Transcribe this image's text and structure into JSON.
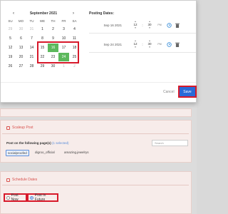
{
  "calendar": {
    "month_label": "September 2021",
    "prev_label": "‹",
    "next_label": "›",
    "weekdays": [
      "SU",
      "MO",
      "TU",
      "WE",
      "TH",
      "FR",
      "SA"
    ],
    "weeks": [
      [
        "29",
        "30",
        "31",
        "1",
        "2",
        "3",
        "4"
      ],
      [
        "5",
        "6",
        "7",
        "8",
        "9",
        "10",
        "11"
      ],
      [
        "12",
        "13",
        "14",
        "15",
        "16",
        "17",
        "18"
      ],
      [
        "19",
        "20",
        "21",
        "22",
        "23",
        "24",
        "25"
      ],
      [
        "26",
        "27",
        "28",
        "29",
        "30",
        "1",
        "2"
      ]
    ]
  },
  "posting": {
    "label": "Posting Dates:",
    "rows": [
      {
        "date": "Sep 16 2021",
        "hour": "12",
        "minute": "30",
        "meridian": "PM"
      },
      {
        "date": "Sep 24 2021",
        "hour": "12",
        "minute": "30",
        "meridian": "PM"
      }
    ],
    "time_up": "▴",
    "time_down": "▾",
    "colon": ":"
  },
  "footer": {
    "cancel_label": "Cancel",
    "save_label": "Save"
  },
  "scaleup": {
    "title": "Scaleup Post",
    "post_on_label": "Post on the following page(s)",
    "selected_count": "(1 selected)",
    "search_placeholder": "Search",
    "pages": [
      "socialproofed",
      "digroo_official",
      "amazing.jewelrys"
    ]
  },
  "schedule": {
    "title": "Schedule Dates",
    "post_now_label": "Post Now",
    "post_in_future_label": "Post In Future"
  },
  "colors": {
    "accent": "#2a6ad8",
    "selected_day": "#5cb85c",
    "highlight": "#d7192a"
  }
}
